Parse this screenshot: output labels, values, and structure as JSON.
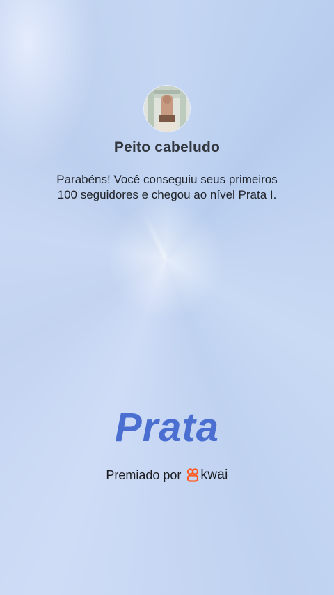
{
  "profile": {
    "name": "Peito cabeludo",
    "avatar_icon": "user-avatar-photo"
  },
  "message": {
    "line1": "Parabéns! Você conseguiu seus primeiros",
    "line2": "100 seguidores e chegou ao nível Prata I."
  },
  "level": {
    "title": "Prata"
  },
  "footer": {
    "awarded_by": "Premiado por",
    "brand": "kwai",
    "brand_icon": "kwai-logo-icon"
  },
  "colors": {
    "level_text": "#4a6fd0",
    "brand_orange": "#ff5a1f"
  }
}
